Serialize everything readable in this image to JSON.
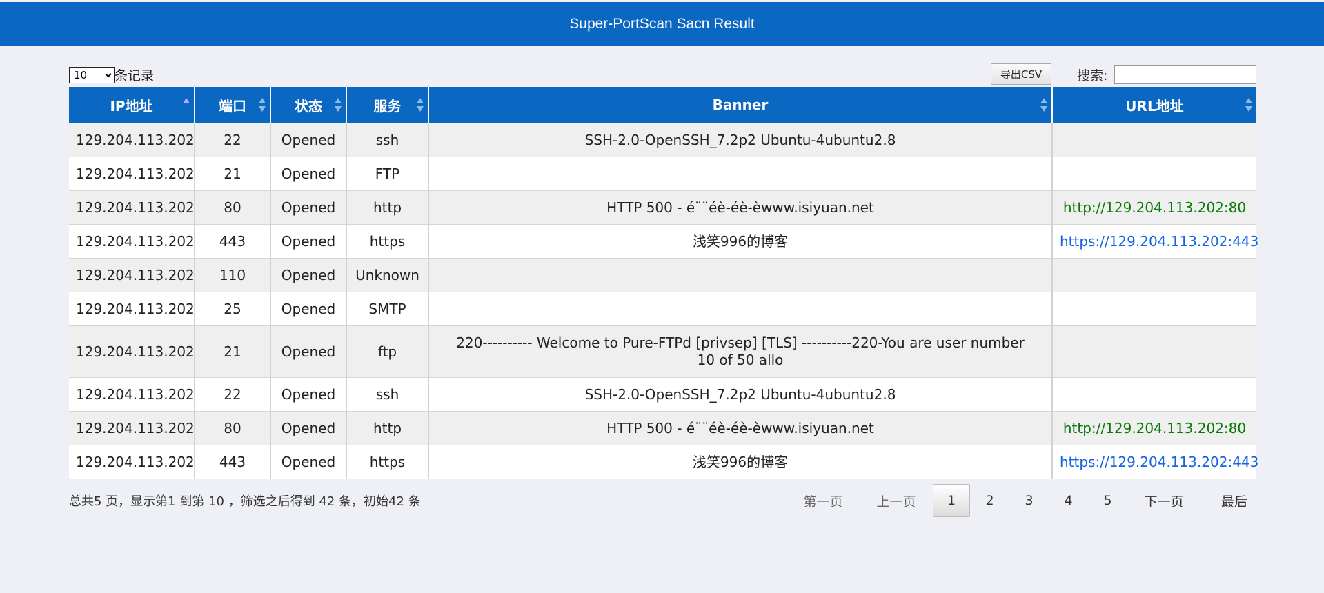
{
  "header": {
    "title": "Super-PortScan Sacn Result"
  },
  "length_menu": {
    "selected": "10",
    "suffix": "条记录"
  },
  "export": {
    "label": "导出CSV"
  },
  "search": {
    "label": "搜索:",
    "value": ""
  },
  "table": {
    "columns": [
      "IP地址",
      "端口",
      "状态",
      "服务",
      "Banner",
      "URL地址"
    ],
    "rows": [
      {
        "ip": "129.204.113.202",
        "port": "22",
        "status": "Opened",
        "service": "ssh",
        "banner": "SSH-2.0-OpenSSH_7.2p2 Ubuntu-4ubuntu2.8",
        "url": ""
      },
      {
        "ip": "129.204.113.202",
        "port": "21",
        "status": "Opened",
        "service": "FTP",
        "banner": "",
        "url": ""
      },
      {
        "ip": "129.204.113.202",
        "port": "80",
        "status": "Opened",
        "service": "http",
        "banner": "HTTP 500 - é¨¨éè-éè-èwww.isiyuan.net",
        "url": "http://129.204.113.202:80"
      },
      {
        "ip": "129.204.113.202",
        "port": "443",
        "status": "Opened",
        "service": "https",
        "banner": "浅笑996的博客",
        "url": "https://129.204.113.202:443"
      },
      {
        "ip": "129.204.113.202",
        "port": "110",
        "status": "Opened",
        "service": "Unknown",
        "banner": "",
        "url": ""
      },
      {
        "ip": "129.204.113.202",
        "port": "25",
        "status": "Opened",
        "service": "SMTP",
        "banner": "",
        "url": ""
      },
      {
        "ip": "129.204.113.202",
        "port": "21",
        "status": "Opened",
        "service": "ftp",
        "banner": "220---------- Welcome to Pure-FTPd [privsep] [TLS] ----------220-You are user number 10 of 50 allo",
        "url": ""
      },
      {
        "ip": "129.204.113.202",
        "port": "22",
        "status": "Opened",
        "service": "ssh",
        "banner": "SSH-2.0-OpenSSH_7.2p2 Ubuntu-4ubuntu2.8",
        "url": ""
      },
      {
        "ip": "129.204.113.202",
        "port": "80",
        "status": "Opened",
        "service": "http",
        "banner": "HTTP 500 - é¨¨éè-éè-èwww.isiyuan.net",
        "url": "http://129.204.113.202:80"
      },
      {
        "ip": "129.204.113.202",
        "port": "443",
        "status": "Opened",
        "service": "https",
        "banner": "浅笑996的博客",
        "url": "https://129.204.113.202:443"
      }
    ]
  },
  "info": {
    "text": "总共5 页，显示第1 到第 10 ，筛选之后得到 42 条，初始42 条"
  },
  "pagination": {
    "first": "第一页",
    "prev": "上一页",
    "pages": [
      "1",
      "2",
      "3",
      "4",
      "5"
    ],
    "current": "1",
    "next": "下一页",
    "last": "最后"
  },
  "colors": {
    "header_blue": "#0a67c2",
    "http_link": "#0a7a0a",
    "https_link": "#1565e0",
    "background": "#eef0f5"
  }
}
